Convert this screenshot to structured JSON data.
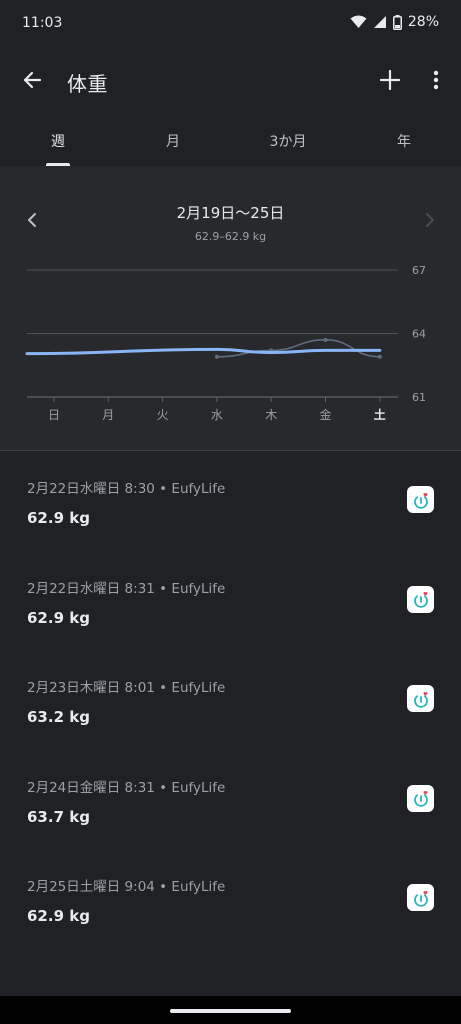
{
  "status_bar": {
    "time": "11:03",
    "battery": "28%",
    "icons": [
      "wifi-icon",
      "signal-icon",
      "battery-icon"
    ]
  },
  "app_bar": {
    "title": "体重",
    "back_icon": "arrow-back-icon",
    "add_icon": "plus-icon",
    "more_icon": "more-vert-icon"
  },
  "tabs": [
    {
      "label": "週",
      "active": true
    },
    {
      "label": "月",
      "active": false
    },
    {
      "label": "3か月",
      "active": false
    },
    {
      "label": "年",
      "active": false
    }
  ],
  "range": {
    "title": "2月19日〜25日",
    "subtitle": "62.9–62.9 kg"
  },
  "chart_data": {
    "type": "line",
    "categories": [
      "日",
      "月",
      "火",
      "水",
      "木",
      "金",
      "土"
    ],
    "y_ticks": [
      "67",
      "64",
      "61"
    ],
    "ylim": [
      61,
      67
    ],
    "grid": true,
    "series": [
      {
        "color": "#8ab4f8",
        "smoothed": true,
        "x": [
          -0.5,
          3,
          4,
          5,
          6
        ],
        "y": [
          63.05,
          63.25,
          63.1,
          63.2,
          63.2
        ]
      },
      {
        "color": "#5f6d80",
        "smoothed": true,
        "x": [
          3,
          4,
          5,
          6
        ],
        "y": [
          62.9,
          63.2,
          63.7,
          62.9
        ]
      }
    ]
  },
  "entries": [
    {
      "meta": "2月22日水曜日 8:30 • EufyLife",
      "value": "62.9 kg"
    },
    {
      "meta": "2月22日水曜日 8:31 • EufyLife",
      "value": "62.9 kg"
    },
    {
      "meta": "2月23日木曜日 8:01 • EufyLife",
      "value": "63.2 kg"
    },
    {
      "meta": "2月24日金曜日 8:31 • EufyLife",
      "value": "63.7 kg"
    },
    {
      "meta": "2月25日土曜日 9:04 • EufyLife",
      "value": "62.9 kg"
    }
  ],
  "colors": {
    "background": "#202124",
    "panel": "#28292c",
    "accent_line": "#8ab4f8",
    "app_icon_teal": "#2bb5b8",
    "app_icon_heart": "#e8425a"
  }
}
